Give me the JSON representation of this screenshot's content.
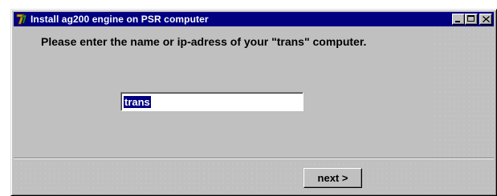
{
  "window": {
    "title": "Install ag200 engine on PSR computer",
    "icon": "app-logo-icon",
    "controls": {
      "minimize_icon": "minimize-icon",
      "maximize_icon": "maximize-icon",
      "close_glyph": "✕"
    }
  },
  "dialog": {
    "prompt": "Please enter the name or ip-adress of your \"trans\" computer.",
    "input_value": "trans",
    "next_label": "next >"
  },
  "colors": {
    "titlebar": "#000080",
    "face": "#c0c0c0",
    "selection": "#000080"
  }
}
